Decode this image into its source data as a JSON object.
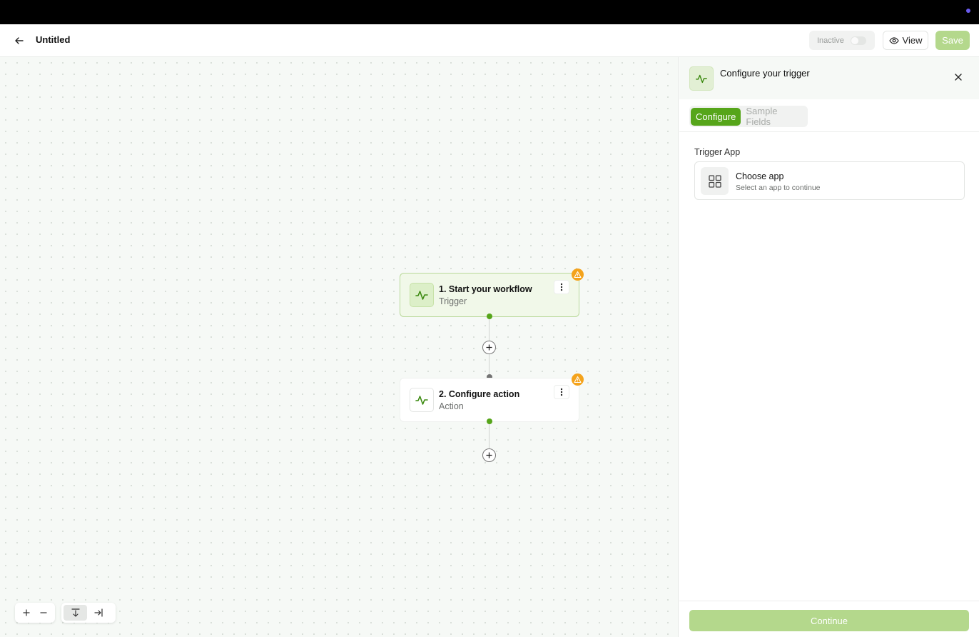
{
  "header": {
    "title": "Untitled",
    "status_label": "Inactive",
    "view_label": "View",
    "save_label": "Save"
  },
  "canvas": {
    "nodes": [
      {
        "title": "1. Start your workflow",
        "subtitle": "Trigger",
        "icon": "activity-icon",
        "warning_icon": "warning-icon"
      },
      {
        "title": "2. Configure action",
        "subtitle": "Action",
        "icon": "activity-icon",
        "warning_icon": "warning-icon"
      }
    ],
    "controls": [
      "zoom-in-icon",
      "zoom-out-icon",
      "vertical-layout-icon",
      "horizontal-layout-icon"
    ]
  },
  "panel": {
    "title": "Configure your trigger",
    "tabs": [
      {
        "label": "Configure",
        "active": true
      },
      {
        "label": "Sample Fields",
        "active": false
      }
    ],
    "field_label": "Trigger App",
    "app_card": {
      "title": "Choose app",
      "subtitle": "Select an app to continue",
      "icon": "grid-icon"
    },
    "continue_label": "Continue"
  },
  "colors": {
    "accent": "#56a51a",
    "accent_disabled": "#b4d88c",
    "warning": "#f4a31c"
  }
}
